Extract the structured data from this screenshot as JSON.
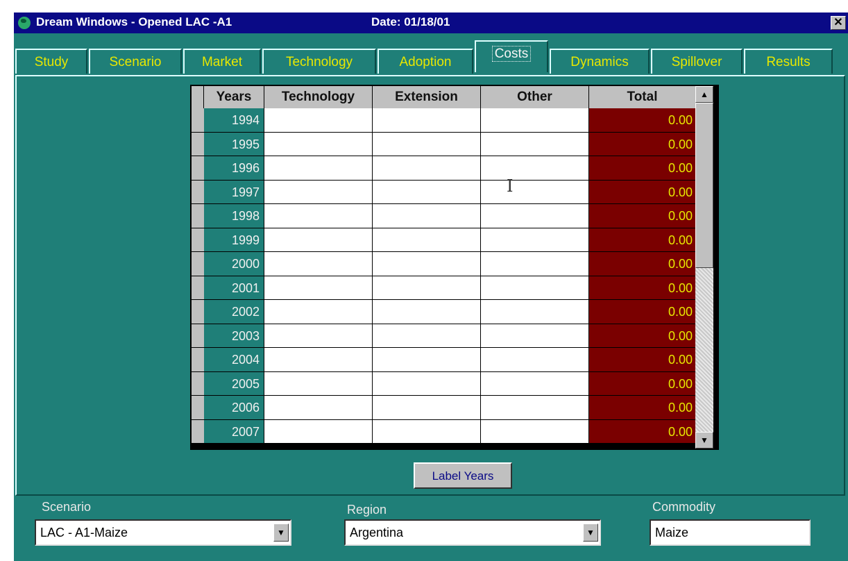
{
  "window": {
    "title": "Dream Windows - Opened LAC -A1",
    "date": "Date: 01/18/01",
    "close": "✕"
  },
  "tabs": [
    "Study",
    "Scenario",
    "Market",
    "Technology",
    "Adoption",
    "Costs",
    "Dynamics",
    "Spillover",
    "Results"
  ],
  "active_tab": "Costs",
  "grid": {
    "headers": {
      "years": "Years",
      "technology": "Technology",
      "extension": "Extension",
      "other": "Other",
      "total": "Total"
    },
    "rows": [
      {
        "year": "1994",
        "total": "0.00"
      },
      {
        "year": "1995",
        "total": "0.00"
      },
      {
        "year": "1996",
        "total": "0.00"
      },
      {
        "year": "1997",
        "total": "0.00"
      },
      {
        "year": "1998",
        "total": "0.00"
      },
      {
        "year": "1999",
        "total": "0.00"
      },
      {
        "year": "2000",
        "total": "0.00"
      },
      {
        "year": "2001",
        "total": "0.00"
      },
      {
        "year": "2002",
        "total": "0.00"
      },
      {
        "year": "2003",
        "total": "0.00"
      },
      {
        "year": "2004",
        "total": "0.00"
      },
      {
        "year": "2005",
        "total": "0.00"
      },
      {
        "year": "2006",
        "total": "0.00"
      },
      {
        "year": "2007",
        "total": "0.00"
      }
    ]
  },
  "buttons": {
    "label_years": "Label Years"
  },
  "footer": {
    "scenario_label": "Scenario",
    "scenario_value": "LAC - A1-Maize",
    "region_label": "Region",
    "region_value": "Argentina",
    "commodity_label": "Commodity",
    "commodity_value": "Maize"
  },
  "colors": {
    "panel": "#1f7f78",
    "total_cell": "#7a0000",
    "tab_text": "#e8e800",
    "titlebar": "#0a0a86"
  }
}
